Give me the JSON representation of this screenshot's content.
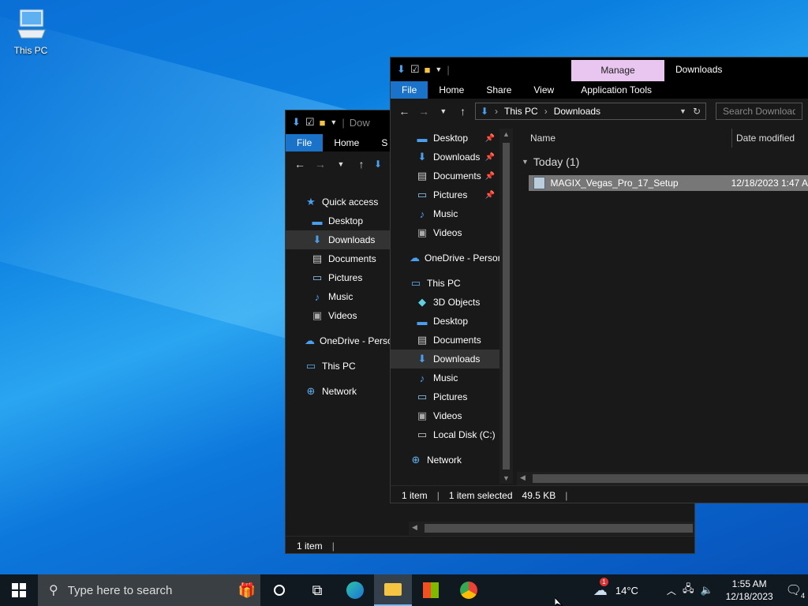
{
  "desktop": {
    "this_pc_label": "This PC"
  },
  "back_window": {
    "title_partial": "Dow",
    "tabs": [
      "File",
      "Home",
      "S"
    ],
    "nav": [
      {
        "label": "Quick access",
        "icon": "star-icon"
      },
      {
        "label": "Desktop",
        "icon": "desktop-icon"
      },
      {
        "label": "Downloads",
        "icon": "download-icon"
      },
      {
        "label": "Documents",
        "icon": "documents-icon"
      },
      {
        "label": "Pictures",
        "icon": "pictures-icon"
      },
      {
        "label": "Music",
        "icon": "music-icon"
      },
      {
        "label": "Videos",
        "icon": "videos-icon"
      },
      {
        "label": "OneDrive - Perso",
        "icon": "onedrive-icon"
      },
      {
        "label": "This PC",
        "icon": "pc-icon"
      },
      {
        "label": "Network",
        "icon": "network-icon"
      }
    ],
    "status": "1 item"
  },
  "front_window": {
    "manage_tab": "Manage",
    "title": "Downloads",
    "tabs": [
      "File",
      "Home",
      "Share",
      "View",
      "Application Tools"
    ],
    "breadcrumb": [
      "This PC",
      "Downloads"
    ],
    "search_placeholder": "Search Downloads",
    "nav": [
      {
        "label": "Desktop",
        "icon": "desktop-icon",
        "pinned": true
      },
      {
        "label": "Downloads",
        "icon": "download-icon",
        "pinned": true
      },
      {
        "label": "Documents",
        "icon": "documents-icon",
        "pinned": true
      },
      {
        "label": "Pictures",
        "icon": "pictures-icon",
        "pinned": true
      },
      {
        "label": "Music",
        "icon": "music-icon"
      },
      {
        "label": "Videos",
        "icon": "videos-icon"
      },
      {
        "label": "OneDrive - Person",
        "icon": "onedrive-icon"
      },
      {
        "label": "This PC",
        "icon": "pc-icon"
      },
      {
        "label": "3D Objects",
        "icon": "3d-objects-icon"
      },
      {
        "label": "Desktop",
        "icon": "desktop-icon"
      },
      {
        "label": "Documents",
        "icon": "documents-icon"
      },
      {
        "label": "Downloads",
        "icon": "download-icon",
        "selected": true
      },
      {
        "label": "Music",
        "icon": "music-icon"
      },
      {
        "label": "Pictures",
        "icon": "pictures-icon"
      },
      {
        "label": "Videos",
        "icon": "videos-icon"
      },
      {
        "label": "Local Disk (C:)",
        "icon": "disk-icon"
      },
      {
        "label": "Network",
        "icon": "network-icon"
      }
    ],
    "columns": {
      "name": "Name",
      "date": "Date modified"
    },
    "group_header": "Today (1)",
    "files": [
      {
        "name": "MAGIX_Vegas_Pro_17_Setup",
        "date": "12/18/2023 1:47 A"
      }
    ],
    "status": {
      "count": "1 item",
      "selected": "1 item selected",
      "size": "49.5 KB"
    }
  },
  "taskbar": {
    "search_placeholder": "Type here to search",
    "weather_temp": "14°C",
    "weather_badge": "1",
    "time": "1:55 AM",
    "date": "12/18/2023",
    "notification_count": "4"
  }
}
